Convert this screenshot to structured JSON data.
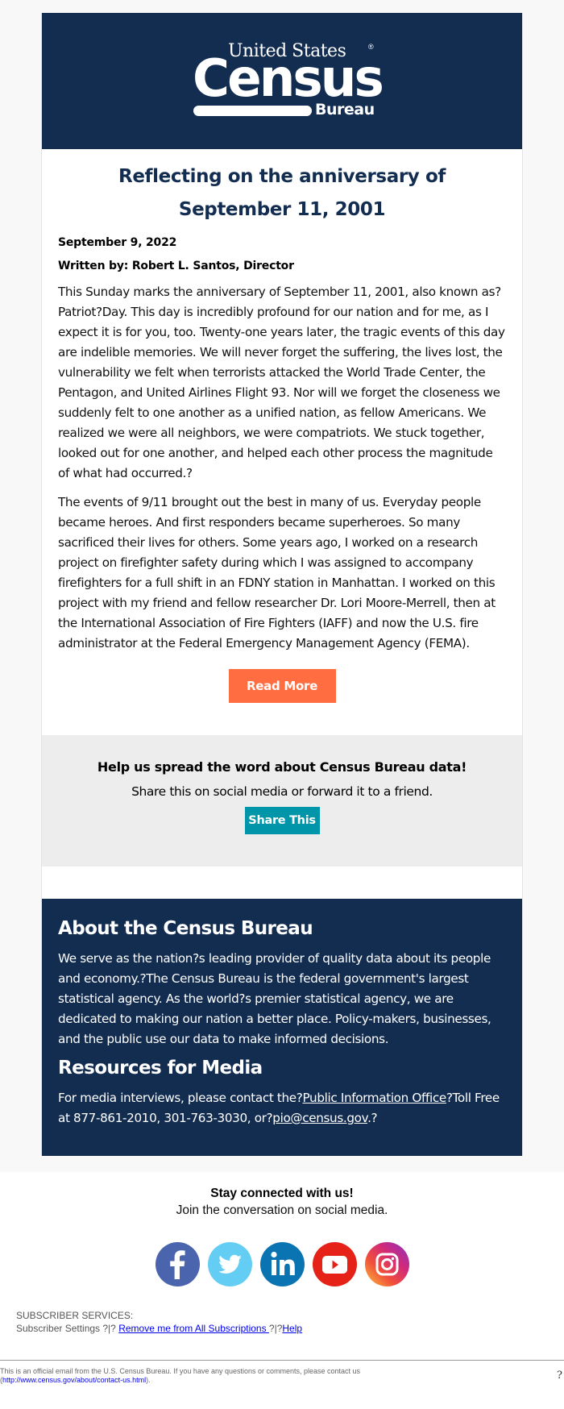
{
  "header": {
    "logo_line1": "United States",
    "logo_reg": "®",
    "logo_line2": "Census",
    "logo_line3": "Bureau"
  },
  "article": {
    "title_line1": "Reflecting on the anniversary of",
    "title_line2": "September 11, 2001",
    "date": "September 9, 2022",
    "byline": "Written by: Robert L. Santos, Director",
    "paragraphs": [
      "This Sunday marks the anniversary of September 11, 2001, also known as? Patriot?Day. This day is incredibly profound for our nation and for me, as I expect it is for you, too. Twenty-one years later, the tragic events of this day are indelible memories. We will never forget the suffering, the lives lost, the vulnerability we felt when terrorists attacked the World Trade Center, the Pentagon, and United Airlines Flight 93. Nor will we forget the closeness we suddenly felt to one another as a unified nation, as fellow Americans. We realized we were all neighbors, we were compatriots. We stuck together, looked out for one another, and helped each other process the magnitude of what had occurred.?",
      "The events of 9/11 brought out the best in many of us. Everyday people became heroes. And first responders became superheroes. So many sacrificed their lives for others. Some years ago, I worked on a research project on firefighter safety during which I was assigned to accompany firefighters for a full shift in an FDNY station in Manhattan. I worked on this project with my friend and fellow researcher Dr. Lori Moore-Merrell, then at the International Association of Fire Fighters (IAFF) and now the U.S. fire administrator at the Federal Emergency Management Agency (FEMA)."
    ],
    "read_more_label": "Read More"
  },
  "share": {
    "heading": "Help us spread the word about Census Bureau data!",
    "subtext": "Share this on social media or forward it to a friend.",
    "button_label": "Share This"
  },
  "about": {
    "heading": "About the Census Bureau",
    "text": "We serve as the nation?s leading provider of quality data about its people and economy.?The Census Bureau is the federal government's largest statistical agency. As the world?s premier statistical agency, we are dedicated to making our nation a better place. Policy-makers, businesses, and the public use our data to make informed decisions.",
    "media_heading": "Resources for Media",
    "media_text_before": "For media interviews, please contact the?",
    "media_link": "Public Information Office",
    "media_text_middle": "?Toll Free at 877-861-2010, 301-763-3030, or?",
    "media_email": "pio@census.gov",
    "media_text_after": ".?"
  },
  "social": {
    "heading": "Stay connected with us!",
    "subtext": "Join the conversation on social media.",
    "icons": [
      "facebook-icon",
      "twitter-icon",
      "linkedin-icon",
      "youtube-icon",
      "instagram-icon"
    ]
  },
  "subscriber": {
    "heading": "SUBSCRIBER SERVICES:",
    "settings": "Subscriber Settings ?|? ",
    "remove_link": "Remove me from All Subscriptions ",
    "separator": "?|?",
    "help_link": "Help"
  },
  "footer": {
    "official_text": "This is an official email from the U.S. Census Bureau. If you have any questions or comments, please contact us",
    "contact_open": "(",
    "contact_link": "http://www.census.gov/about/contact-us.html",
    "contact_close": ").",
    "trailing_mark": "?"
  },
  "colors": {
    "navy": "#132d51",
    "read_more": "#ff6d40",
    "share_button": "#0095a8",
    "share_bg": "#ededed"
  }
}
